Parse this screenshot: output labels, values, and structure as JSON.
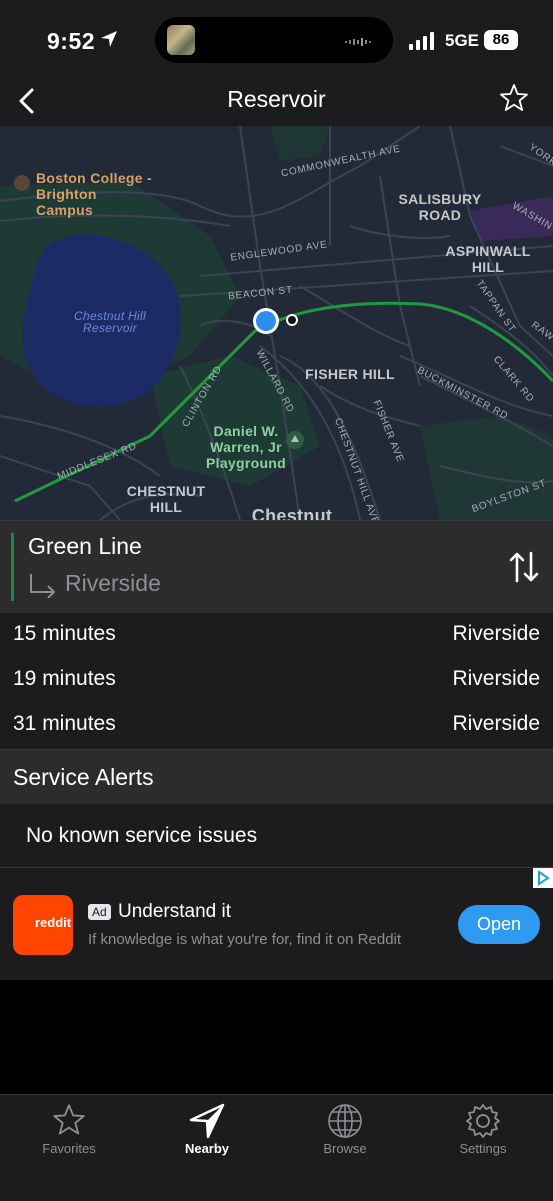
{
  "status_bar": {
    "time": "9:52",
    "network": "5GE",
    "battery": "86"
  },
  "nav": {
    "title": "Reservoir"
  },
  "map": {
    "places": [
      "Boston College - Brighton Campus",
      "Chestnut Hill Reservoir",
      "SALISBURY ROAD",
      "ASPINWALL HILL",
      "FISHER HILL",
      "Daniel W. Warren, Jr Playground",
      "CHESTNUT HILL",
      "Chestnut"
    ],
    "streets": [
      "COMMONWEALTH AVE",
      "ENGLEWOOD AVE",
      "BEACON ST",
      "CLINTON RD",
      "WILLARD RD",
      "FISHER AVE",
      "CHESTNUT HILL AVE",
      "BUCKMINSTER RD",
      "CLARK RD",
      "TAPPAN ST",
      "BOYLSTON ST",
      "MIDDLESEX RD",
      "WASHIN",
      "YORK",
      "RAW"
    ],
    "line_color": "#1b8a3a"
  },
  "route": {
    "line": "Green Line",
    "destination": "Riverside"
  },
  "predictions": [
    {
      "time": "15 minutes",
      "destination": "Riverside"
    },
    {
      "time": "19 minutes",
      "destination": "Riverside"
    },
    {
      "time": "31 minutes",
      "destination": "Riverside"
    }
  ],
  "alerts": {
    "title": "Service Alerts",
    "message": "No known service issues"
  },
  "ad": {
    "brand": "reddit",
    "badge": "Ad",
    "title": "Understand it",
    "description": "If knowledge is what you're for, find it on Reddit",
    "cta": "Open"
  },
  "tabs": [
    {
      "label": "Favorites",
      "icon": "star-icon",
      "active": false
    },
    {
      "label": "Nearby",
      "icon": "location-arrow-icon",
      "active": true
    },
    {
      "label": "Browse",
      "icon": "globe-icon",
      "active": false
    },
    {
      "label": "Settings",
      "icon": "gear-icon",
      "active": false
    }
  ]
}
